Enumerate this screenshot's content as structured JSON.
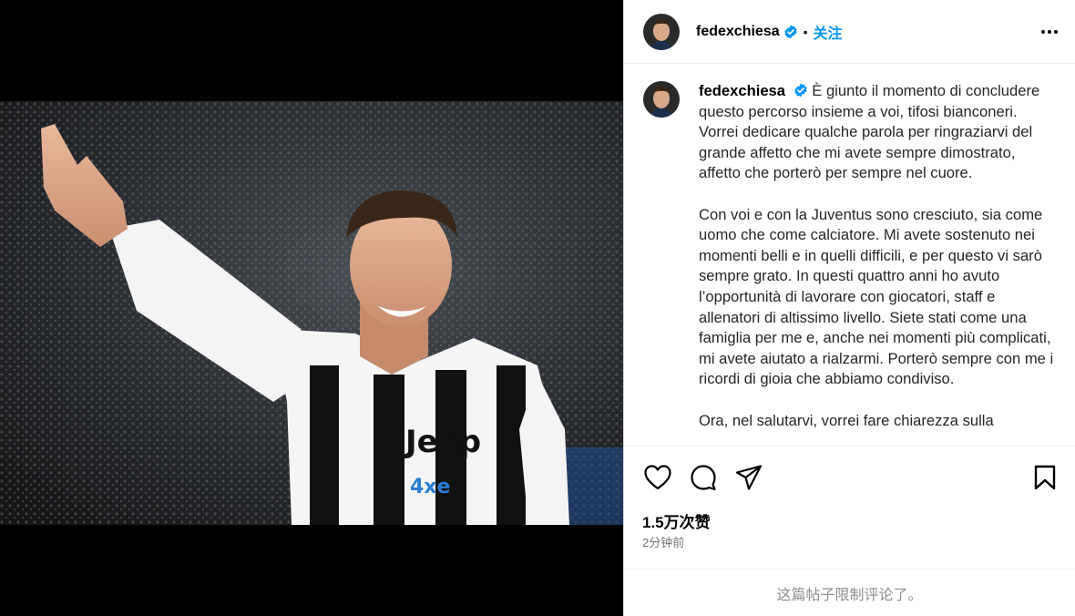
{
  "post": {
    "username": "fedexchiesa",
    "follow_label": "关注",
    "separator": "•",
    "verified": true
  },
  "caption": {
    "username": "fedexchiesa",
    "paragraphs": [
      "È giunto il momento di concludere questo percorso insieme a voi, tifosi bianconeri. Vorrei dedicare qualche parola per ringraziarvi del grande affetto che mi avete sempre dimostrato, affetto che porterò per sempre nel cuore.",
      "Con voi e con la Juventus sono cresciuto, sia come uomo che come calciatore. Mi avete sostenuto nei momenti belli e in quelli difficili, e per questo vi sarò sempre grato. In questi quattro anni ho avuto l’opportunità di lavorare con giocatori, staff e allenatori di altissimo livello. Siete stati come una famiglia per me e, anche nei momenti più complicati, mi avete aiutato a rialzarmi. Porterò sempre con me i ricordi di gioia che abbiamo condiviso.",
      "Ora, nel salutarvi, vorrei fare chiarezza sulla"
    ]
  },
  "stats": {
    "likes": "1.5万次赞",
    "time": "2分钟前"
  },
  "comments": {
    "limited_text": "这篇帖子限制评论了。"
  },
  "icons": {
    "verified": "verified-badge-icon",
    "more": "more-options-icon",
    "like": "heart-icon",
    "comment": "comment-icon",
    "share": "share-icon",
    "save": "bookmark-icon"
  },
  "colors": {
    "link": "#0095f6",
    "verified": "#0095f6",
    "muted": "#737373",
    "border": "#dbdbdb"
  }
}
